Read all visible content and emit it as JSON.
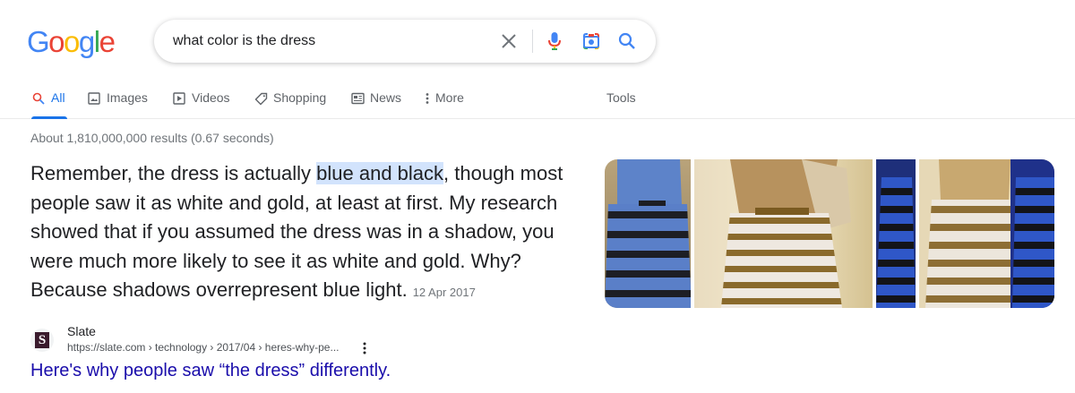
{
  "logo": {
    "letters": [
      "G",
      "o",
      "o",
      "g",
      "l",
      "e"
    ],
    "colors": [
      "#4285f4",
      "#ea4335",
      "#fbbc05",
      "#4285f4",
      "#34a853",
      "#ea4335"
    ]
  },
  "search": {
    "query": "what color is the dress",
    "icons": [
      "close-icon",
      "microphone-icon",
      "camera-lens-icon",
      "search-icon"
    ]
  },
  "tabs": [
    {
      "label": "All",
      "icon": "search-icon",
      "active": true
    },
    {
      "label": "Images",
      "icon": "image-icon",
      "active": false
    },
    {
      "label": "Videos",
      "icon": "play-icon",
      "active": false
    },
    {
      "label": "Shopping",
      "icon": "tag-icon",
      "active": false
    },
    {
      "label": "News",
      "icon": "newspaper-icon",
      "active": false
    },
    {
      "label": "More",
      "icon": "more-vert-icon",
      "active": false
    }
  ],
  "tools_label": "Tools",
  "result_stats": "About 1,810,000,000 results (0.67 seconds)",
  "snippet": {
    "before": "Remember, the dress is actually ",
    "highlight": "blue and black",
    "after": ", though most people saw it as white and gold, at least at first. My research showed that if you assumed the dress was in a shadow, you were much more likely to see it as white and gold. Why? Because shadows overrepresent blue light.",
    "date": "12 Apr 2017"
  },
  "result": {
    "site_name": "Slate",
    "favicon_letter": "S",
    "url": "https://slate.com › technology › 2017/04 › heres-why-pe...",
    "title": "Here's why people saw “the dress” differently."
  },
  "colors": {
    "accent": "#1a73e8",
    "link": "#1a0dab",
    "highlight": "#d2e3fc",
    "muted": "#70757a"
  }
}
